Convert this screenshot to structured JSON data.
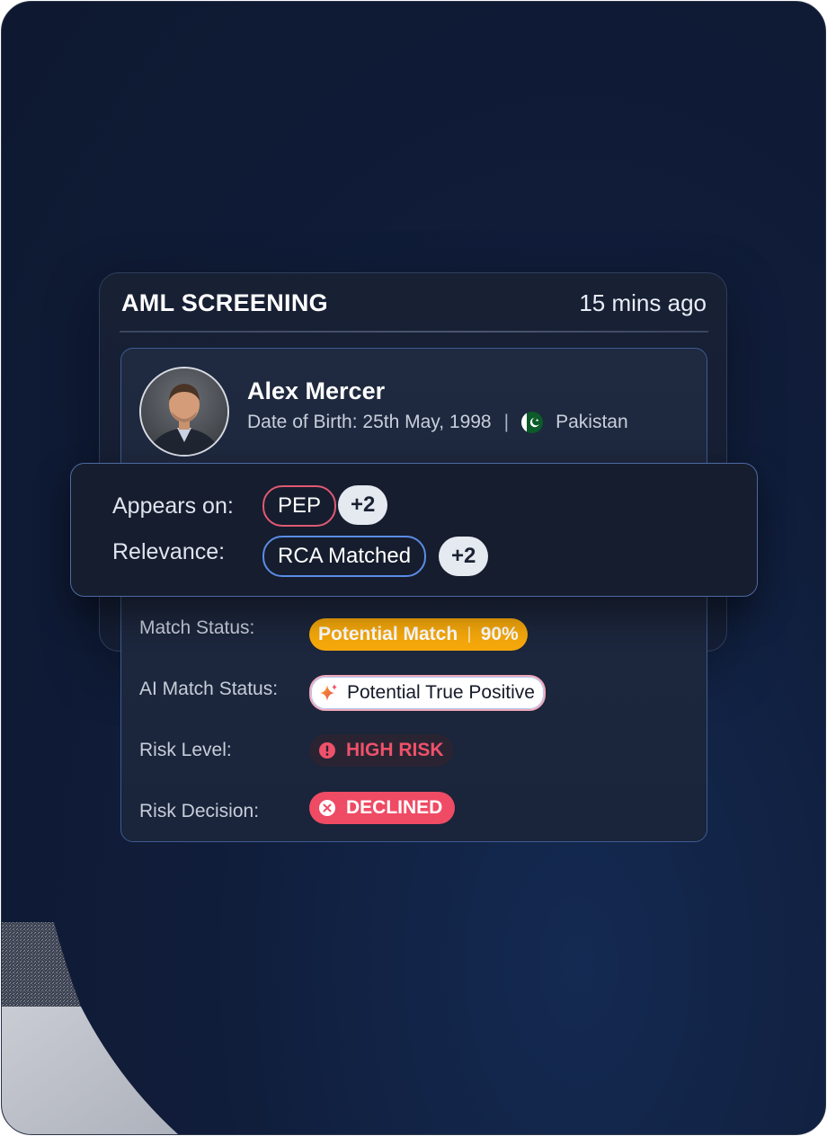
{
  "card": {
    "title": "AML SCREENING",
    "time": "15 mins ago"
  },
  "profile": {
    "name": "Alex Mercer",
    "dob_label": "Date of Birth:",
    "dob_value": "25th May, 1998",
    "separator": "|",
    "country": "Pakistan",
    "country_flag_icon": "pakistan-flag-icon"
  },
  "screening": {
    "appears_on_label": "Appears on:",
    "appears_on_tag": "PEP",
    "appears_on_more": "+2",
    "relevance_label": "Relevance:",
    "relevance_tag": "RCA Matched",
    "relevance_more": "+2"
  },
  "status": {
    "match_status_label": "Match Status:",
    "match_status_value": "Potential Match",
    "match_percent": "90%",
    "ai_match_label": "AI Match Status:",
    "ai_match_value": "Potential True Positive",
    "risk_level_label": "Risk Level:",
    "risk_level_value": "HIGH RISK",
    "risk_decision_label": "Risk Decision:",
    "risk_decision_value": "DECLINED"
  },
  "colors": {
    "match": "#f7a90b",
    "high_risk": "#f0516a",
    "declined": "#ef4b64",
    "pep_border": "#e05a72",
    "rca_border": "#5a8de8"
  }
}
